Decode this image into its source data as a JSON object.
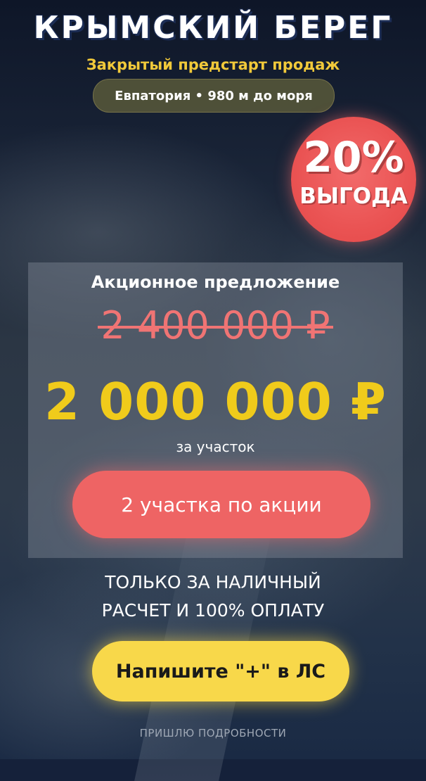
{
  "header": {
    "title": "КРЫМСКИЙ БЕРЕГ",
    "subtitle": "Закрытый предстарт продаж",
    "location": "Евпатория • 980 м до моря"
  },
  "badge": {
    "percent": "20%",
    "label": "ВЫГОДА"
  },
  "offer": {
    "heading": "Акционное предложение",
    "old_price": "2 400 000 ₽",
    "new_price": "2 000 000 ₽",
    "unit": "за участок",
    "promo_button": "2 участка по акции"
  },
  "terms": {
    "line1": "ТОЛЬКО ЗА НАЛИЧНЫЙ",
    "line2": "РАСЧЕТ И 100% ОПЛАТУ"
  },
  "cta": {
    "button": "Напишите \"+\" в ЛС",
    "note": "ПРИШЛЮ ПОДРОБНОСТИ"
  },
  "colors": {
    "accent_yellow": "#f0cb1b",
    "accent_red": "#ee6464",
    "old_price": "#f07474"
  }
}
